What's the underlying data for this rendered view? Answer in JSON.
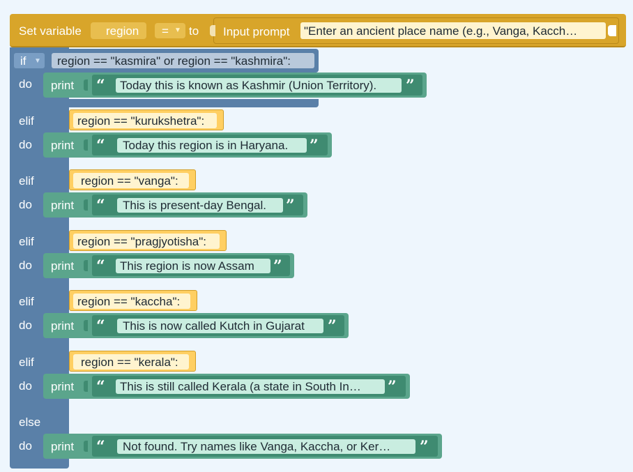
{
  "set_variable": {
    "label": "Set variable",
    "variable": "region",
    "operator": "=",
    "to_label": "to",
    "input_label": "Input prompt",
    "prompt_text": "\"Enter an ancient place name (e.g., Vanga, Kacch…"
  },
  "if_block": {
    "keyword": "if",
    "condition": "region == \"kasmira\" or region == \"kashmira\":",
    "do_label": "do",
    "print_label": "print",
    "message": "Today this is known as Kashmir (Union Territory)."
  },
  "elif_blocks": [
    {
      "keyword": "elif",
      "condition": "region == \"kurukshetra\":",
      "do_label": "do",
      "print_label": "print",
      "message": "Today this region is in Haryana."
    },
    {
      "keyword": "elif",
      "condition": "region == \"vanga\":",
      "do_label": "do",
      "print_label": "print",
      "message": "This is present-day Bengal."
    },
    {
      "keyword": "elif",
      "condition": "region == \"pragjyotisha\":",
      "do_label": "do",
      "print_label": "print",
      "message": "This region is now Assam"
    },
    {
      "keyword": "elif",
      "condition": "region == \"kaccha\":",
      "do_label": "do",
      "print_label": "print",
      "message": "This is now called Kutch in Gujarat"
    },
    {
      "keyword": "elif",
      "condition": "region == \"kerala\":",
      "do_label": "do",
      "print_label": "print",
      "message": "This is still called Kerala (a state in South In…"
    }
  ],
  "else_block": {
    "keyword": "else",
    "do_label": "do",
    "print_label": "print",
    "message": "Not found. Try names like Vanga, Kaccha, or Ker…"
  },
  "quote_open": "“",
  "quote_close": "”",
  "colors": {
    "variable_block": "#d8a52a",
    "control_block": "#5a80a8",
    "print_block": "#5ba58c",
    "condition_block": "#ffcf62",
    "background": "#eef6fd"
  }
}
